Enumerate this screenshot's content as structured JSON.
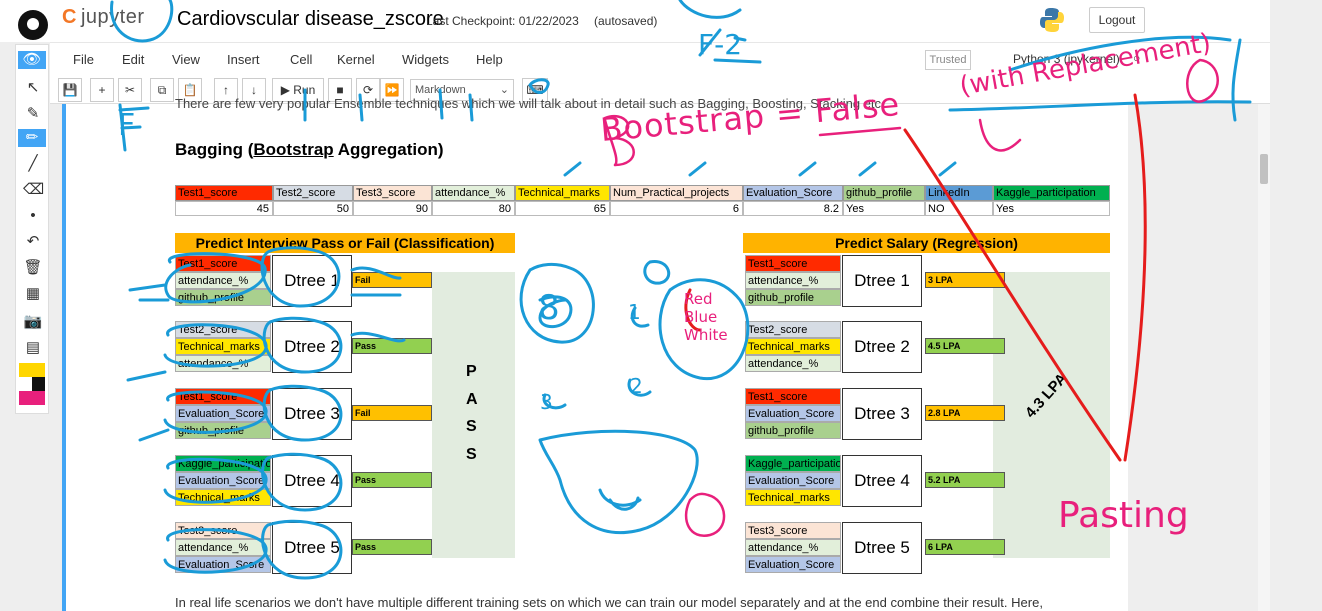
{
  "header": {
    "logo_text": "jupyter",
    "notebook_title": "Cardiovscular disease_zscore",
    "checkpoint": "Last Checkpoint: 01/22/2023",
    "autosave": "(autosaved)",
    "logout_label": "Logout"
  },
  "menu": {
    "items": [
      "File",
      "Edit",
      "View",
      "Insert",
      "Cell",
      "Kernel",
      "Widgets",
      "Help"
    ],
    "trusted": "Trusted",
    "kernel": "Python 3 (ipykernel)"
  },
  "toolbar": {
    "run_label": "Run",
    "cell_type": "Markdown"
  },
  "notebook": {
    "intro_text": "There are few very popular Ensemble techniques which we will talk about in detail such as Bagging, Boosting, Stacking etc.",
    "heading_prefix": "Bagging (",
    "heading_underlined": "Bootstrap",
    "heading_suffix": " Aggregation)",
    "bottom_text": "In real life scenarios we don't have multiple different training sets on which we can train our model separately and at the end combine their result. Here,"
  },
  "table": {
    "headers": [
      "Test1_score",
      "Test2_score",
      "Test3_score",
      "attendance_%",
      "Technical_marks",
      "Num_Practical_projects",
      "Evaluation_Score",
      "github_profile",
      "LinkedIn",
      "Kaggle_participation"
    ],
    "values": [
      "45",
      "50",
      "90",
      "80",
      "65",
      "6",
      "8.2",
      "Yes",
      "NO",
      "Yes"
    ],
    "header_colors": [
      "#ff2a00",
      "#d6dce4",
      "#fbe4d5",
      "#e2efda",
      "#ffe600",
      "#fce4d6",
      "#b4c6e7",
      "#a9d08e",
      "#5b9bd5",
      "#00b050"
    ]
  },
  "classification": {
    "title": "Predict Interview Pass or Fail (Classification)",
    "groups": [
      {
        "features": [
          "Test1_score",
          "attendance_%",
          "github_profile"
        ],
        "tree": "Dtree 1",
        "result": "Fail"
      },
      {
        "features": [
          "Test2_score",
          "Technical_marks",
          "attendance_%"
        ],
        "tree": "Dtree 2",
        "result": "Pass"
      },
      {
        "features": [
          "Test1_score",
          "Evaluation_Score",
          "github_profile"
        ],
        "tree": "Dtree 3",
        "result": "Fail"
      },
      {
        "features": [
          "Kaggle_participation",
          "Evaluation_Score",
          "Technical_marks"
        ],
        "tree": "Dtree 4",
        "result": "Pass"
      },
      {
        "features": [
          "Test3_score",
          "attendance_%",
          "Evaluation_Score"
        ],
        "tree": "Dtree 5",
        "result": "Pass"
      }
    ],
    "final_letters": [
      "P",
      "A",
      "S",
      "S"
    ]
  },
  "regression": {
    "title": "Predict Salary (Regression)",
    "groups": [
      {
        "features": [
          "Test1_score",
          "attendance_%",
          "github_profile"
        ],
        "tree": "Dtree 1",
        "result": "3 LPA"
      },
      {
        "features": [
          "Test2_score",
          "Technical_marks",
          "attendance_%"
        ],
        "tree": "Dtree 2",
        "result": "4.5 LPA"
      },
      {
        "features": [
          "Test1_score",
          "Evaluation_Score",
          "github_profile"
        ],
        "tree": "Dtree 3",
        "result": "2.8 LPA"
      },
      {
        "features": [
          "Kaggle_participation",
          "Evaluation_Score",
          "Technical_marks"
        ],
        "tree": "Dtree 4",
        "result": "5.2 LPA"
      },
      {
        "features": [
          "Test3_score",
          "attendance_%",
          "Evaluation_Score"
        ],
        "tree": "Dtree 5",
        "result": "6 LPA"
      }
    ],
    "final_value": "4.3 LPA"
  },
  "annotations": {
    "bootstrap_note": "Bootstrap = False",
    "with_replacement": "(with Replacement)",
    "pasting": "Pasting",
    "f2": "F-2",
    "f": "F",
    "balls": "Red Blue White",
    "digits": [
      "8",
      "1",
      "2",
      "3"
    ]
  },
  "colors": {
    "fail": "#ffc000",
    "pass": "#92d050",
    "banner": "#ffb300",
    "ink_blue": "#1a9bd7",
    "ink_pink": "#e8207c",
    "ink_red": "#e51c1c"
  }
}
